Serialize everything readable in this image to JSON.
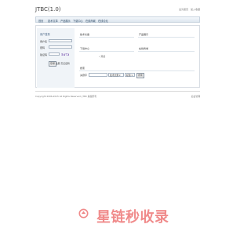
{
  "header": {
    "title": "JTBC(1.0)",
    "links": [
      "设为首页",
      "加入收藏"
    ]
  },
  "nav": {
    "items": [
      "首页",
      "技术文章",
      "产品展示",
      "下载中心",
      "在线商城",
      "在线论坛"
    ]
  },
  "login": {
    "title": "用户登录",
    "username_label": "用户名",
    "password_label": "密码",
    "captcha_label": "验证码",
    "captcha_text": "5472",
    "submit_label": "登录",
    "register_label": "注册",
    "forgot_label": "忘记密码"
  },
  "sections": {
    "articles": "技术文章",
    "products": "产品展示",
    "downloads": "下载中心",
    "shop": "在线商城",
    "shop_item": "测试"
  },
  "search": {
    "title": "搜索",
    "label": "关键字",
    "module_value": "技术文章",
    "field_value": "标题",
    "button_label": "搜索"
  },
  "footer": {
    "copyright": "Copyright 2006-2015 All Rights Reserved. JTBC 版权所有",
    "admin_link": "后台管理"
  },
  "watermark": {
    "text": "星链秒收录"
  },
  "colors": {
    "nav_text": "#2d4a66",
    "watermark": "#f08b8b",
    "login_bg": "#f0f4f8"
  }
}
